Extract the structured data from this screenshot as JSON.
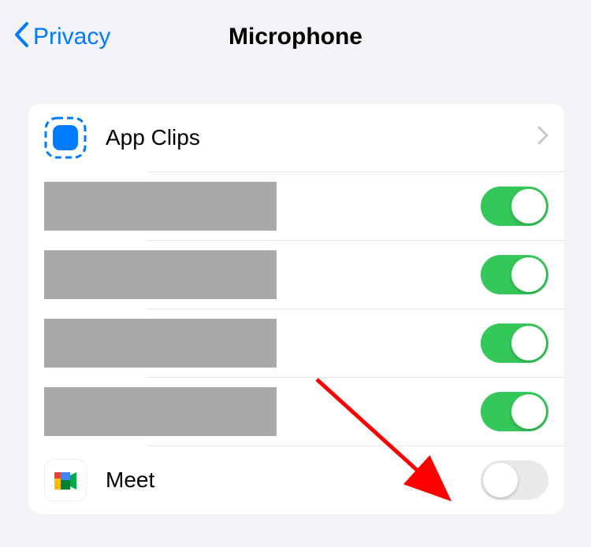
{
  "header": {
    "back_label": "Privacy",
    "title": "Microphone"
  },
  "rows": {
    "app_clips": {
      "label": "App Clips",
      "icon_name": "app-clips-icon"
    },
    "redacted": [
      {
        "toggle_on": true
      },
      {
        "toggle_on": true
      },
      {
        "toggle_on": true
      },
      {
        "toggle_on": true
      }
    ],
    "meet": {
      "label": "Meet",
      "icon_name": "google-meet-icon",
      "toggle_on": false
    }
  },
  "colors": {
    "ios_blue": "#007aff",
    "ios_green": "#34c759",
    "background": "#f2f2f7",
    "redacted": "#a9a9a9",
    "arrow": "#ff0000"
  }
}
